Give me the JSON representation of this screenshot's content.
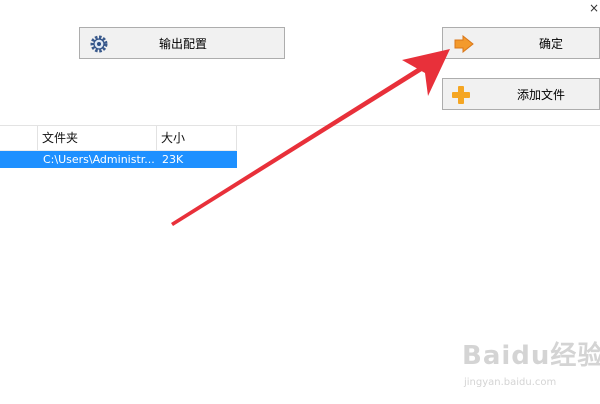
{
  "window": {
    "close_glyph": "×"
  },
  "toolbar": {
    "output_settings_label": "输出配置",
    "confirm_label": "确定",
    "add_file_label": "添加文件"
  },
  "table": {
    "columns": [
      "",
      "文件夹",
      "大小"
    ],
    "rows": [
      {
        "name": "",
        "folder": "C:\\Users\\Administr...",
        "size": "23K"
      }
    ]
  },
  "watermark": {
    "brand": "Baidu经验",
    "url": "jingyan.baidu.com"
  },
  "colors": {
    "selection": "#1e90ff",
    "annotation_arrow": "#e8303a",
    "confirm_icon": "#f39a2c",
    "add_icon": "#f5a623"
  },
  "icons": {
    "output_settings": "gear-icon",
    "confirm": "arrow-right-icon",
    "add_file": "plus-icon",
    "close": "close-icon"
  }
}
